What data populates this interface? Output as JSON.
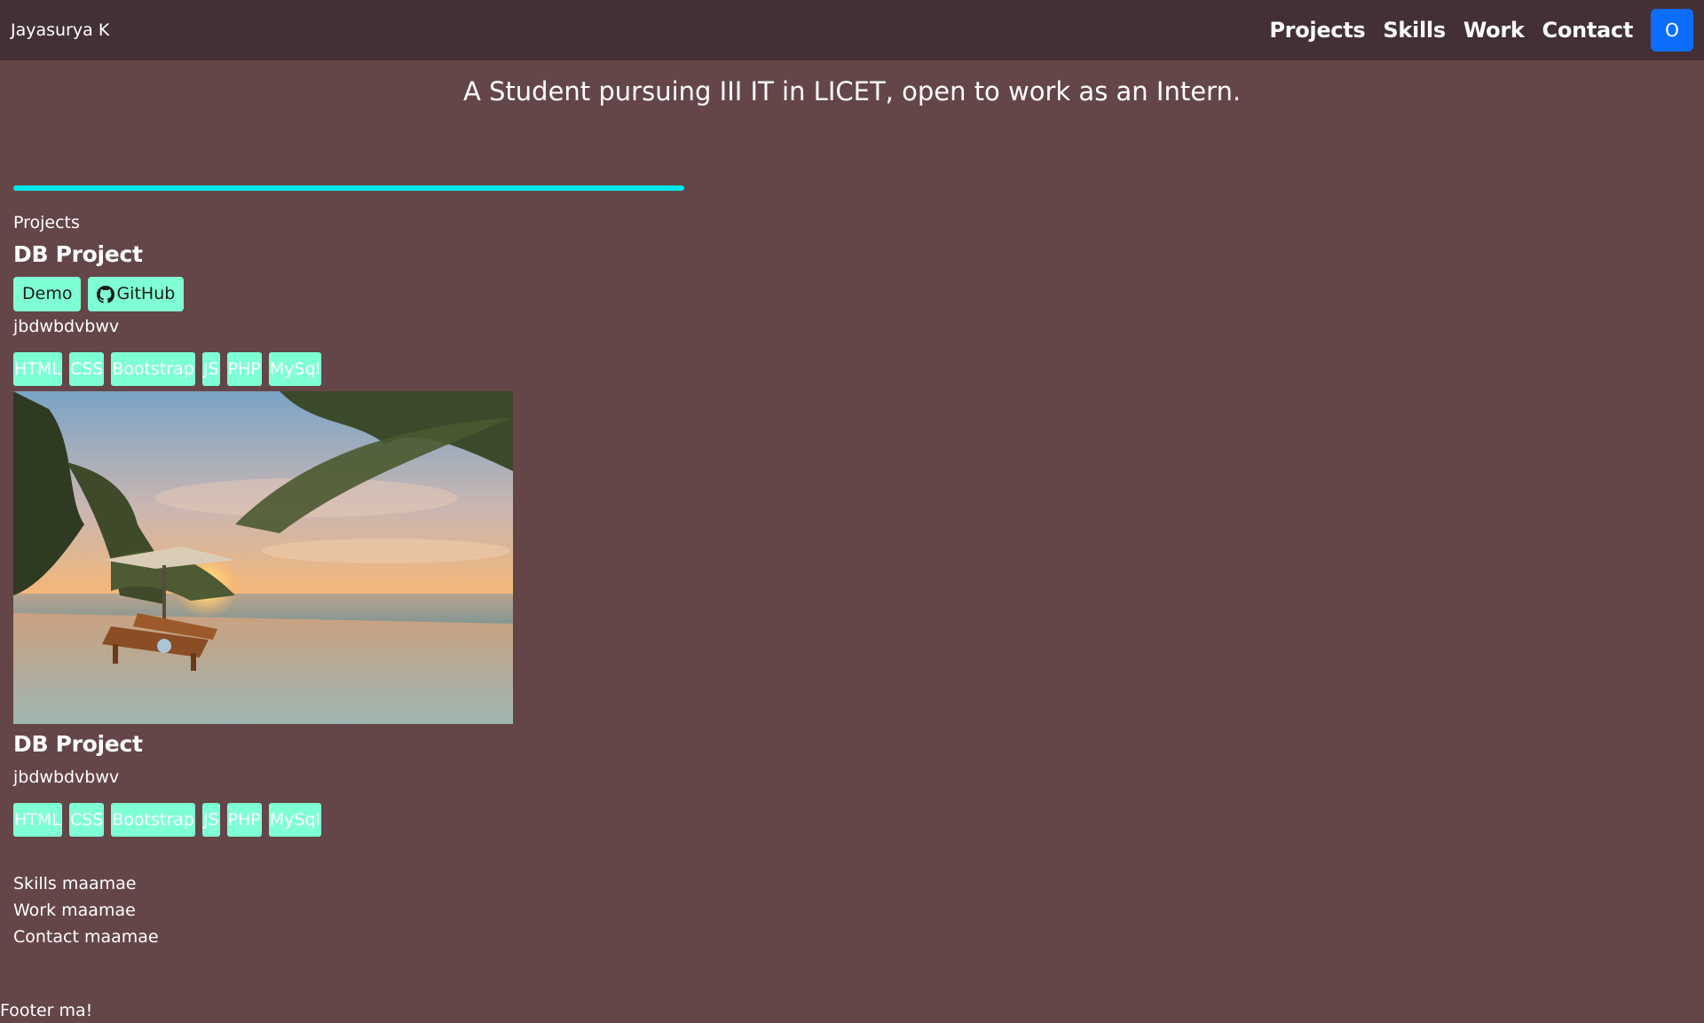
{
  "navbar": {
    "brand": "Jayasurya K",
    "links": [
      "Projects",
      "Skills",
      "Work",
      "Contact"
    ],
    "button_label": "O"
  },
  "hero": {
    "tagline": "A Student pursuing III IT in LICET, open to work as an Intern."
  },
  "projects": {
    "section_label": "Projects",
    "featured": {
      "title": "DB Project",
      "demo_label": "Demo",
      "github_label": "GitHub",
      "description": "jbdwbdvbwv",
      "tags": [
        "HTML",
        "CSS",
        "Bootstrap",
        "JS",
        "PHP",
        "MySql"
      ]
    },
    "second": {
      "title": "DB Project",
      "description": "jbdwbdvbwv",
      "tags": [
        "HTML",
        "CSS",
        "Bootstrap",
        "JS",
        "PHP",
        "MySql"
      ]
    }
  },
  "sections": {
    "skills": "Skills maamae",
    "work": "Work maamae",
    "contact": "Contact maamae"
  },
  "footer": {
    "text": "Footer ma!"
  },
  "colors": {
    "page_bg": "#654648",
    "navbar_bg": "#433034",
    "accent_line": "#00e8ec",
    "button_bg": "#7fffd4",
    "primary_button": "#0d6efd"
  },
  "icons": {
    "github": "github-icon",
    "image": "beach-sunset-photo"
  }
}
